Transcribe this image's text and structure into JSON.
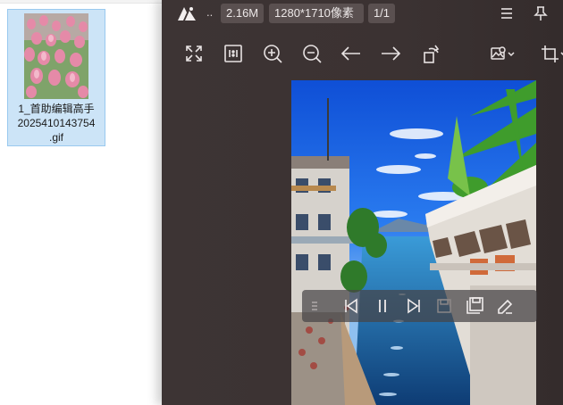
{
  "desktop": {
    "file": {
      "name_line1": "1_首助编辑高手",
      "name_line2": "2025410143754",
      "name_line3": ".gif"
    }
  },
  "viewer": {
    "title_ellipsis": "..",
    "file_size": "2.16M",
    "dimensions": "1280*1710像素",
    "page_counter": "1/1",
    "icons": {
      "logo": "app-logo-icon",
      "menu": "menu-icon",
      "pin": "pin-icon",
      "fullscreen": "fullscreen-icon",
      "actual_size": "actual-size-icon",
      "zoom_in": "zoom-in-icon",
      "zoom_out": "zoom-out-icon",
      "previous": "arrow-left-icon",
      "next": "arrow-right-icon",
      "rotate": "rotate-icon",
      "image_settings": "image-settings-icon",
      "crop": "crop-icon"
    },
    "playback_bar": {
      "icons": [
        "drag-handle-icon",
        "previous-frame-icon",
        "pause-icon",
        "next-frame-icon",
        "save-frame-icon",
        "save-all-icon",
        "edit-icon"
      ]
    }
  },
  "colors": {
    "viewer_bg": "#3b3232",
    "chip_bg": "#5a5050",
    "selection_bg": "#cce4f7",
    "selection_border": "#99c9ef"
  }
}
